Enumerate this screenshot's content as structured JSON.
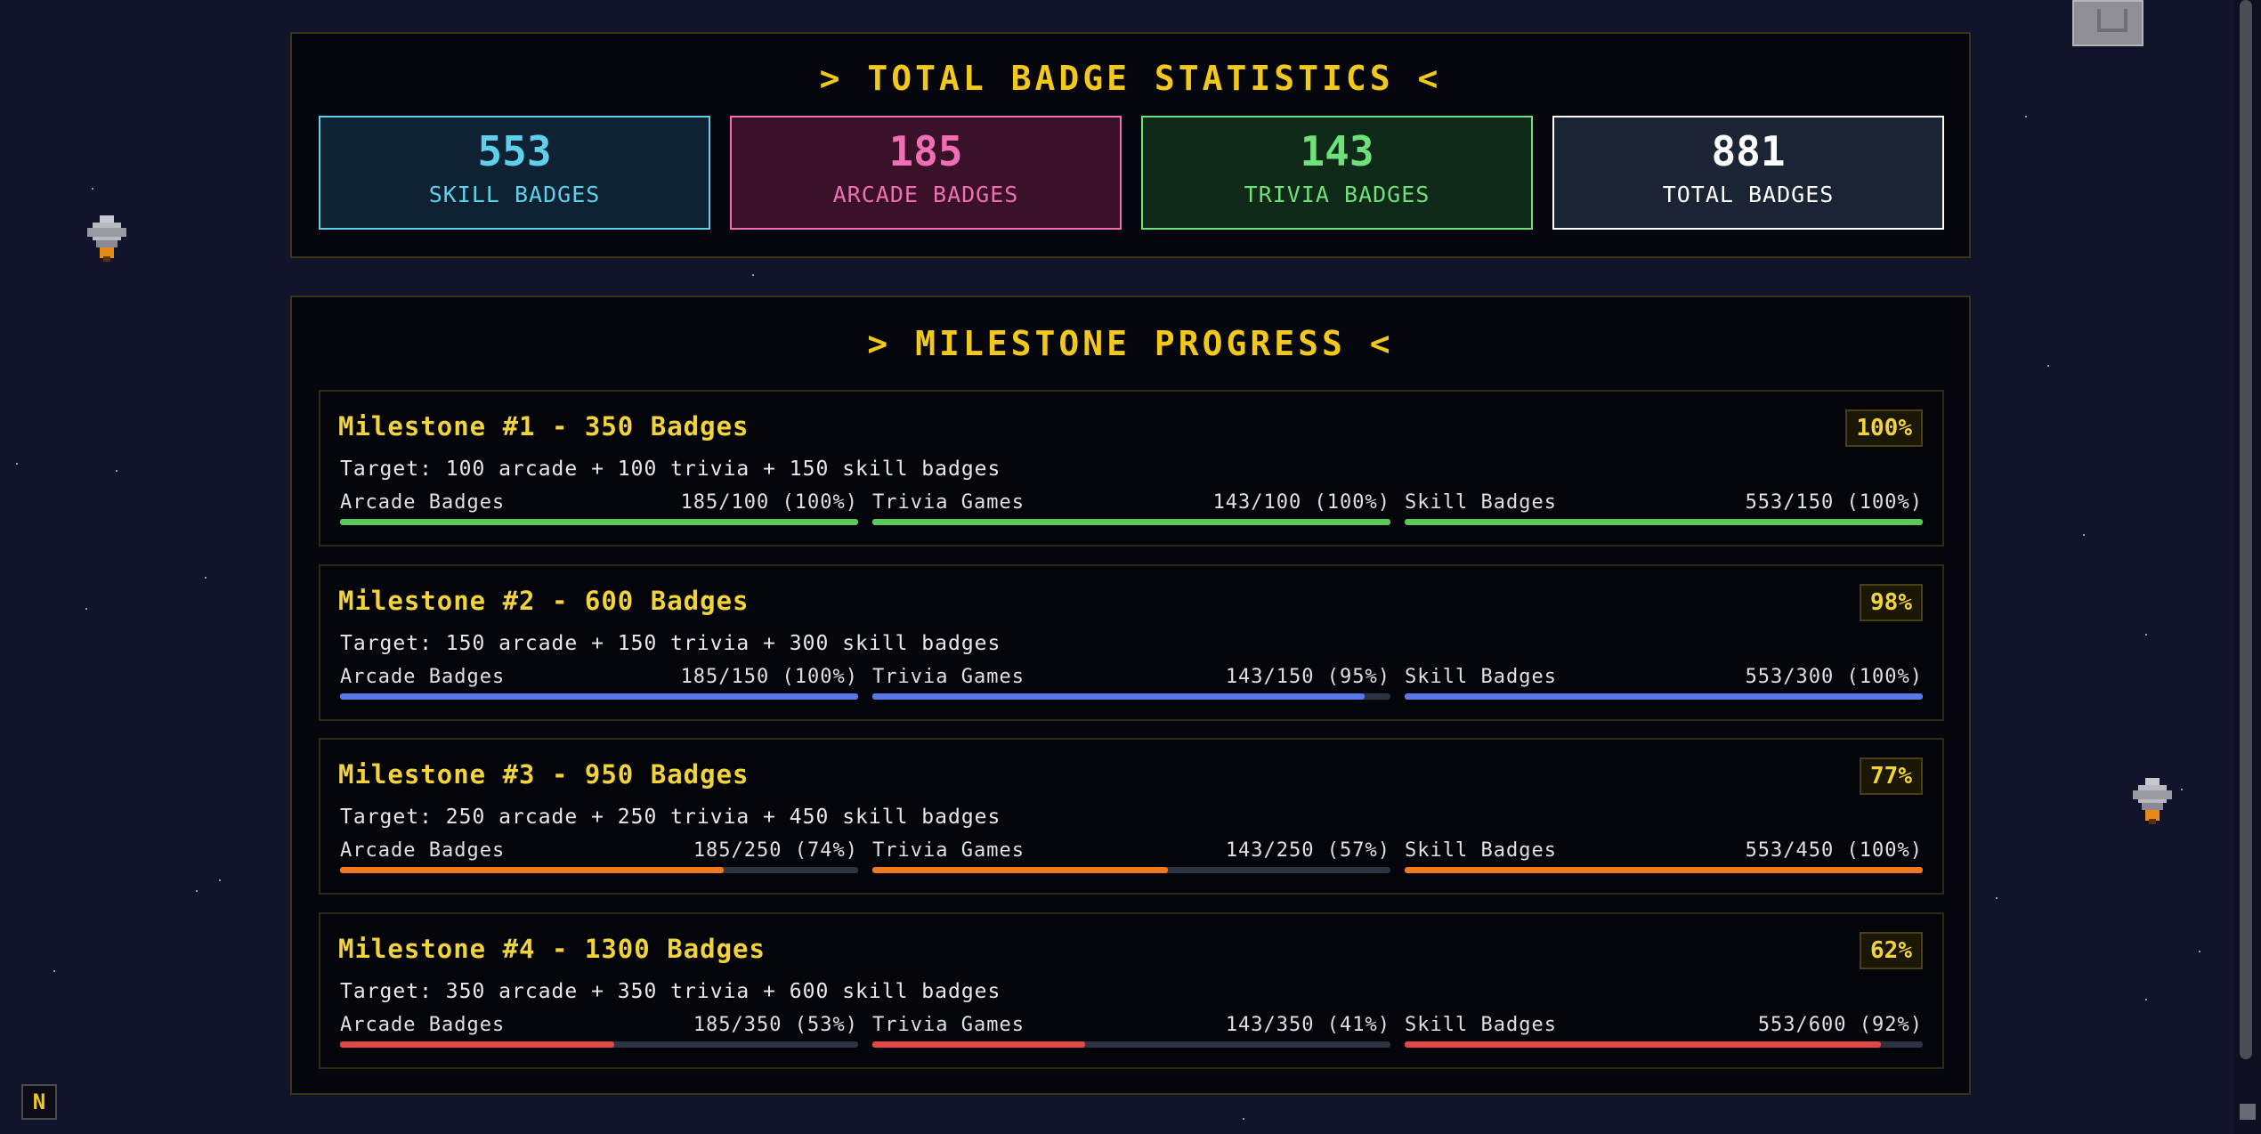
{
  "stats": {
    "title": "> TOTAL BADGE STATISTICS <",
    "boxes": [
      {
        "value": "553",
        "label": "SKILL BADGES",
        "color": "#5fd0ea"
      },
      {
        "value": "185",
        "label": "ARCADE BADGES",
        "color": "#f06fb4"
      },
      {
        "value": "143",
        "label": "TRIVIA BADGES",
        "color": "#6fe07a"
      },
      {
        "value": "881",
        "label": "TOTAL BADGES",
        "color": "#ffffff"
      }
    ]
  },
  "milestones": {
    "title": "> MILESTONE PROGRESS <",
    "items": [
      {
        "title": "Milestone #1 - 350 Badges",
        "percent": "100%",
        "target": "Target: 100 arcade + 100 trivia + 150 skill badges",
        "bar_color": "#5cc85c",
        "progress": [
          {
            "label": "Arcade Badges",
            "value": "185/100 (100%)",
            "fraction": 1.0
          },
          {
            "label": "Trivia Games",
            "value": "143/100 (100%)",
            "fraction": 1.0
          },
          {
            "label": "Skill Badges",
            "value": "553/150 (100%)",
            "fraction": 1.0
          }
        ]
      },
      {
        "title": "Milestone #2 - 600 Badges",
        "percent": "98%",
        "target": "Target: 150 arcade + 150 trivia + 300 skill badges",
        "bar_color": "#5a78e8",
        "progress": [
          {
            "label": "Arcade Badges",
            "value": "185/150 (100%)",
            "fraction": 1.0
          },
          {
            "label": "Trivia Games",
            "value": "143/150 (95%)",
            "fraction": 0.95
          },
          {
            "label": "Skill Badges",
            "value": "553/300 (100%)",
            "fraction": 1.0
          }
        ]
      },
      {
        "title": "Milestone #3 - 950 Badges",
        "percent": "77%",
        "target": "Target: 250 arcade + 250 trivia + 450 skill badges",
        "bar_color": "#f07820",
        "progress": [
          {
            "label": "Arcade Badges",
            "value": "185/250 (74%)",
            "fraction": 0.74
          },
          {
            "label": "Trivia Games",
            "value": "143/250 (57%)",
            "fraction": 0.57
          },
          {
            "label": "Skill Badges",
            "value": "553/450 (100%)",
            "fraction": 1.0
          }
        ]
      },
      {
        "title": "Milestone #4 - 1300 Badges",
        "percent": "62%",
        "target": "Target: 350 arcade + 350 trivia + 600 skill badges",
        "bar_color": "#e04848",
        "progress": [
          {
            "label": "Arcade Badges",
            "value": "185/350 (53%)",
            "fraction": 0.53
          },
          {
            "label": "Trivia Games",
            "value": "143/350 (41%)",
            "fraction": 0.41
          },
          {
            "label": "Skill Badges",
            "value": "553/600 (92%)",
            "fraction": 0.92
          }
        ]
      }
    ]
  },
  "corner_button": {
    "label": "N"
  }
}
